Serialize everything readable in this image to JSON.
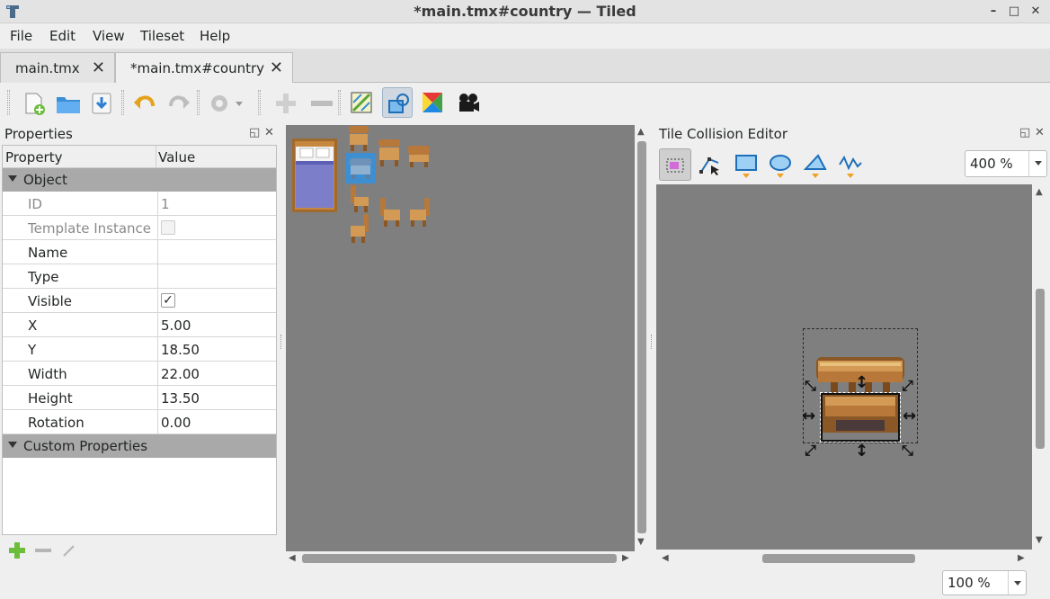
{
  "window": {
    "title": "*main.tmx#country — Tiled"
  },
  "menu": [
    "File",
    "Edit",
    "View",
    "Tileset",
    "Help"
  ],
  "tabs": [
    {
      "label": "main.tmx",
      "active": false
    },
    {
      "label": "*main.tmx#country",
      "active": true
    }
  ],
  "toolbar": {
    "icons": [
      "new-tileset-icon",
      "open-icon",
      "save-icon",
      "undo-icon",
      "redo-icon",
      "settings-icon",
      "add-tile-icon",
      "remove-tile-icon",
      "edit-terrain-icon",
      "edit-collision-icon",
      "wang-sets-icon",
      "animation-icon"
    ]
  },
  "properties": {
    "title": "Properties",
    "header_property": "Property",
    "header_value": "Value",
    "group_object": "Object",
    "group_custom": "Custom Properties",
    "rows": {
      "id": {
        "name": "ID",
        "value": "1"
      },
      "template": {
        "name": "Template Instance"
      },
      "name": {
        "name": "Name",
        "value": ""
      },
      "type": {
        "name": "Type",
        "value": ""
      },
      "visible": {
        "name": "Visible",
        "check": "✓"
      },
      "x": {
        "name": "X",
        "value": "5.00"
      },
      "y": {
        "name": "Y",
        "value": "18.50"
      },
      "width": {
        "name": "Width",
        "value": "22.00"
      },
      "height": {
        "name": "Height",
        "value": "13.50"
      },
      "rotation": {
        "name": "Rotation",
        "value": "0.00"
      }
    }
  },
  "collision": {
    "title": "Tile Collision Editor",
    "zoom": "400 %"
  },
  "bottom": {
    "zoom": "100 %"
  },
  "colors": {
    "accent": "#3d8fd1",
    "canvas": "#7f7f7f",
    "group": "#a9a9a9"
  }
}
